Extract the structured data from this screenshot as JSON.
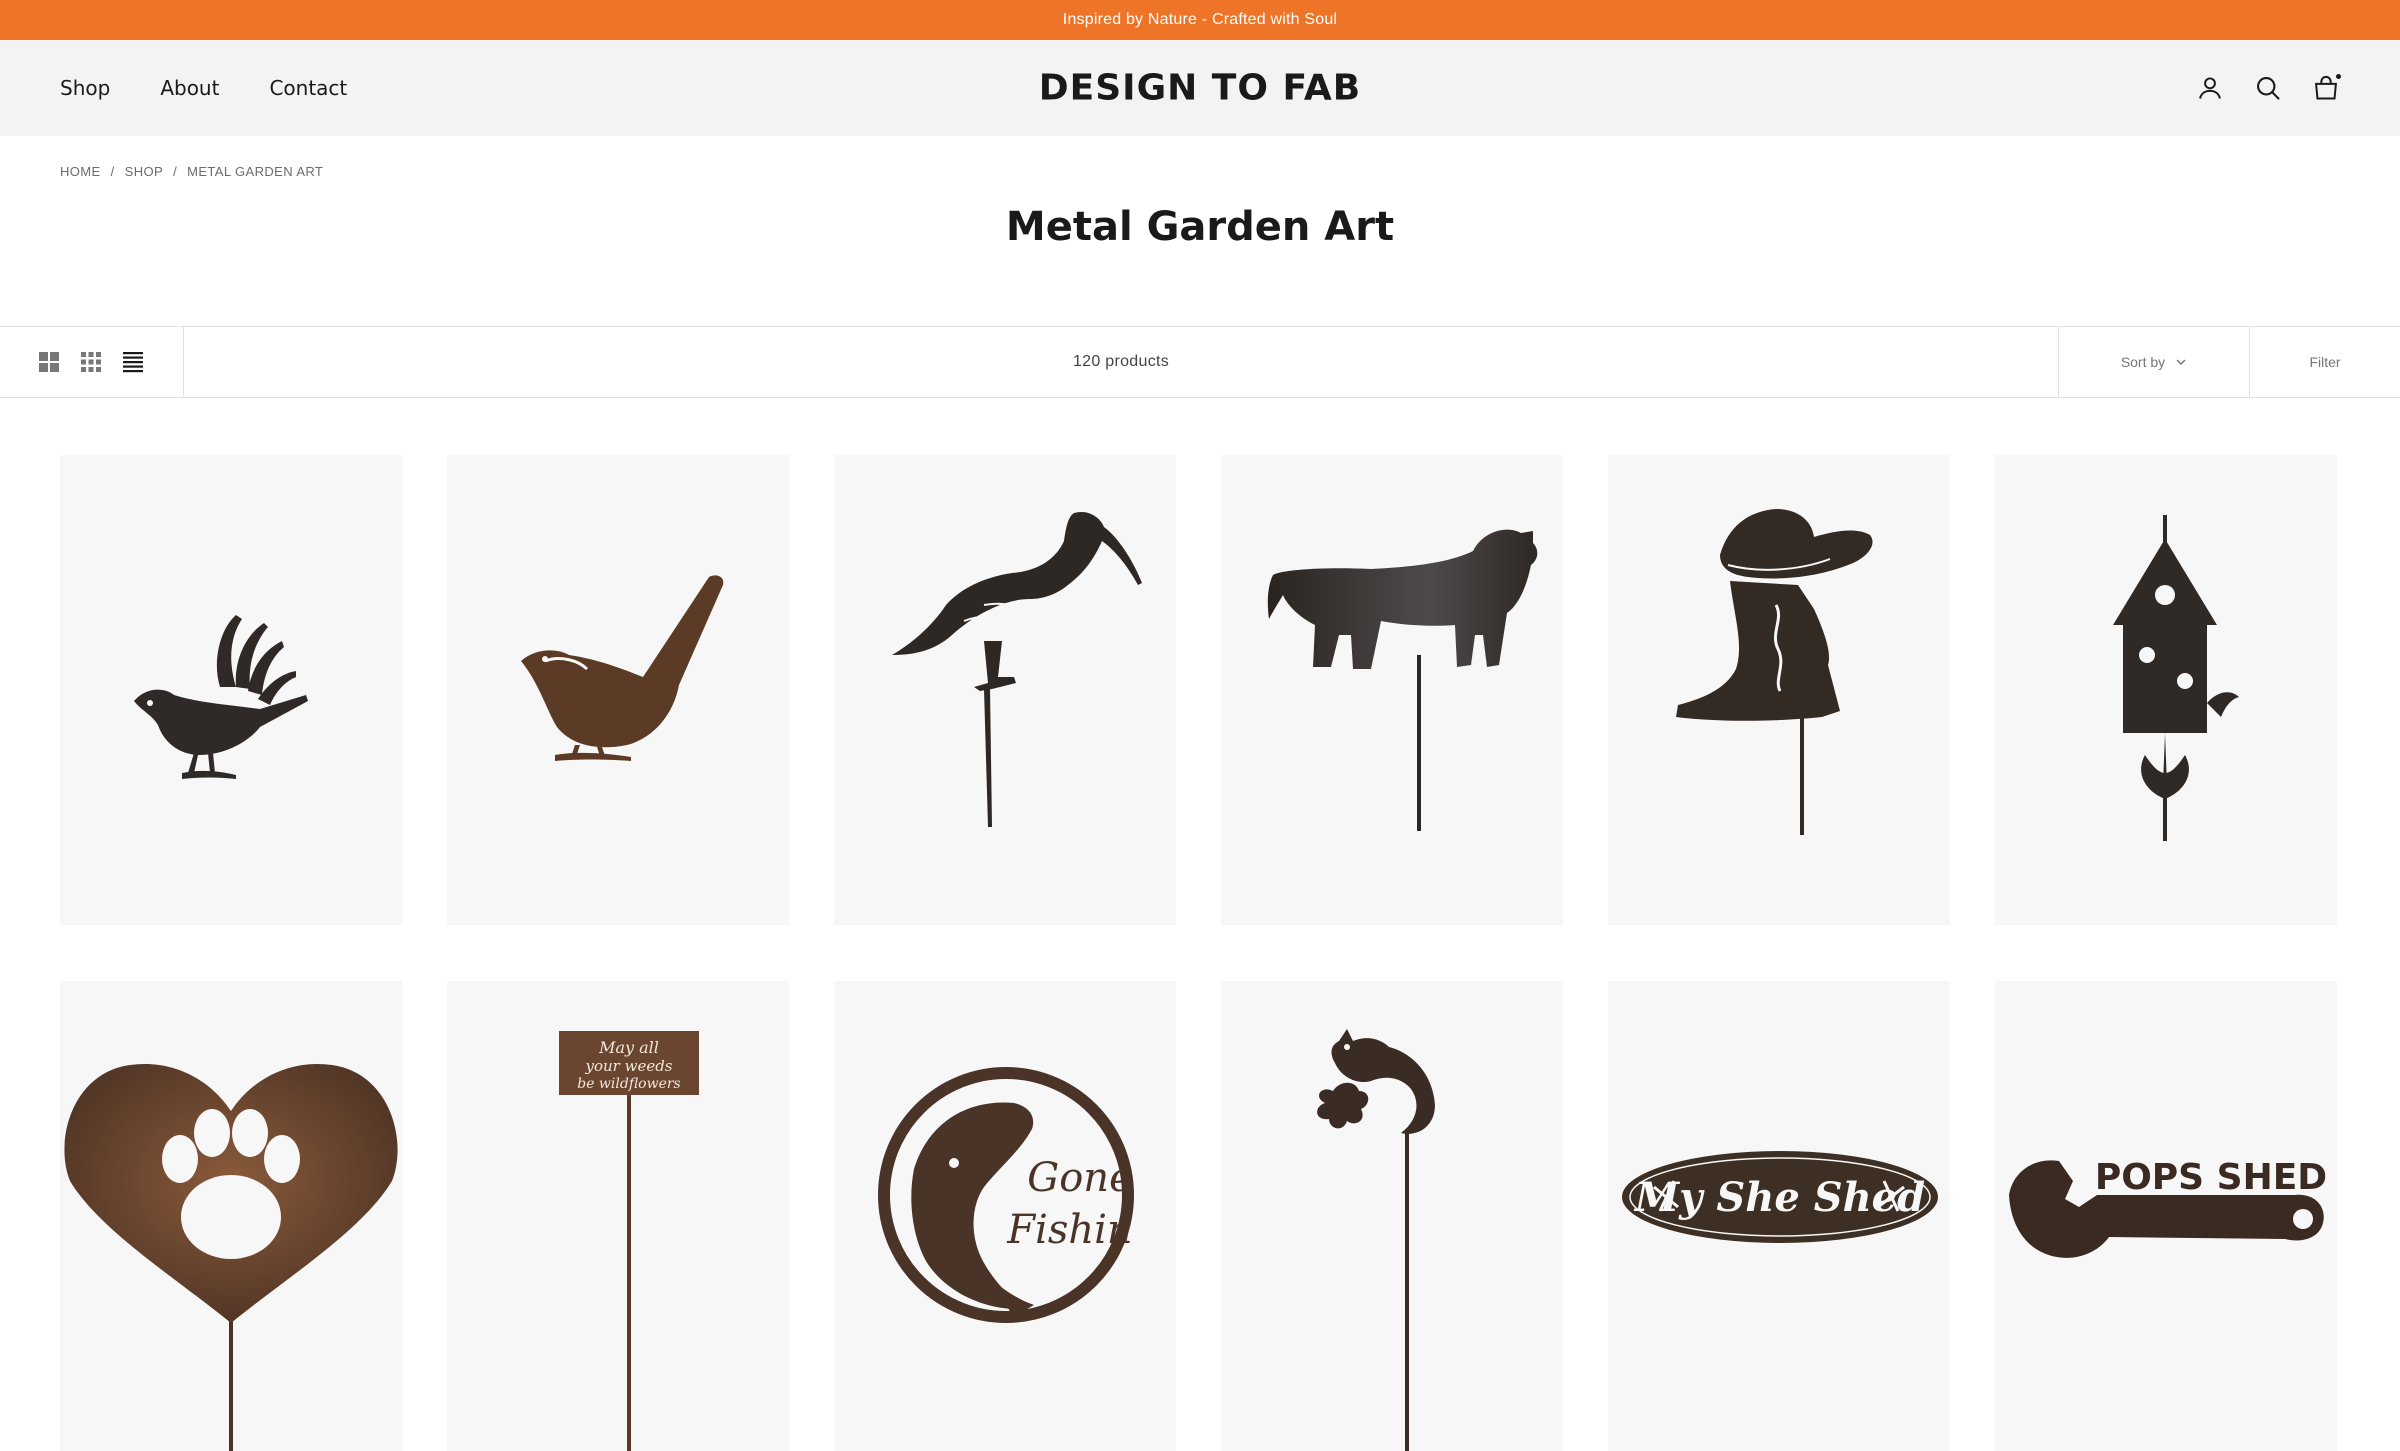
{
  "announcement": "Inspired by Nature - Crafted with Soul",
  "nav": {
    "items": [
      "Shop",
      "About",
      "Contact"
    ]
  },
  "brand": "DESIGN TO FAB",
  "header_icons": [
    "account-icon",
    "search-icon",
    "cart-icon"
  ],
  "breadcrumb": [
    "HOME",
    "SHOP",
    "METAL GARDEN ART"
  ],
  "breadcrumb_separator": "/",
  "page_title": "Metal Garden Art",
  "toolbar": {
    "views": [
      "grid-large-icon",
      "grid-small-icon",
      "list-view-icon"
    ],
    "product_count": "120 products",
    "sort_label": "Sort by",
    "filter_label": "Filter"
  },
  "products": [
    {
      "icon": "fantail-bird-silhouette"
    },
    {
      "icon": "wren-bird-silhouette"
    },
    {
      "icon": "ibis-stake-silhouette"
    },
    {
      "icon": "highland-cow-stake-silhouette"
    },
    {
      "icon": "cowboy-boot-hat-stake-silhouette"
    },
    {
      "icon": "birdhouse-silhouette"
    },
    {
      "icon": "heart-paw-print"
    },
    {
      "icon": "garden-sign-stake",
      "text": "May all your weeds be wildflowers"
    },
    {
      "icon": "fish-ring-sign",
      "text": "Gone Fishin"
    },
    {
      "icon": "possum-stake-silhouette"
    },
    {
      "icon": "oval-sign",
      "text": "My She Shed"
    },
    {
      "icon": "wrench-sign",
      "text": "POPS SHED"
    }
  ],
  "colors": {
    "announcement_bg": "#ee7427",
    "header_bg": "#f3f3f3",
    "metal": "#3e2f25",
    "rust": "#6a4530",
    "card_bg": "#f7f7f7"
  }
}
